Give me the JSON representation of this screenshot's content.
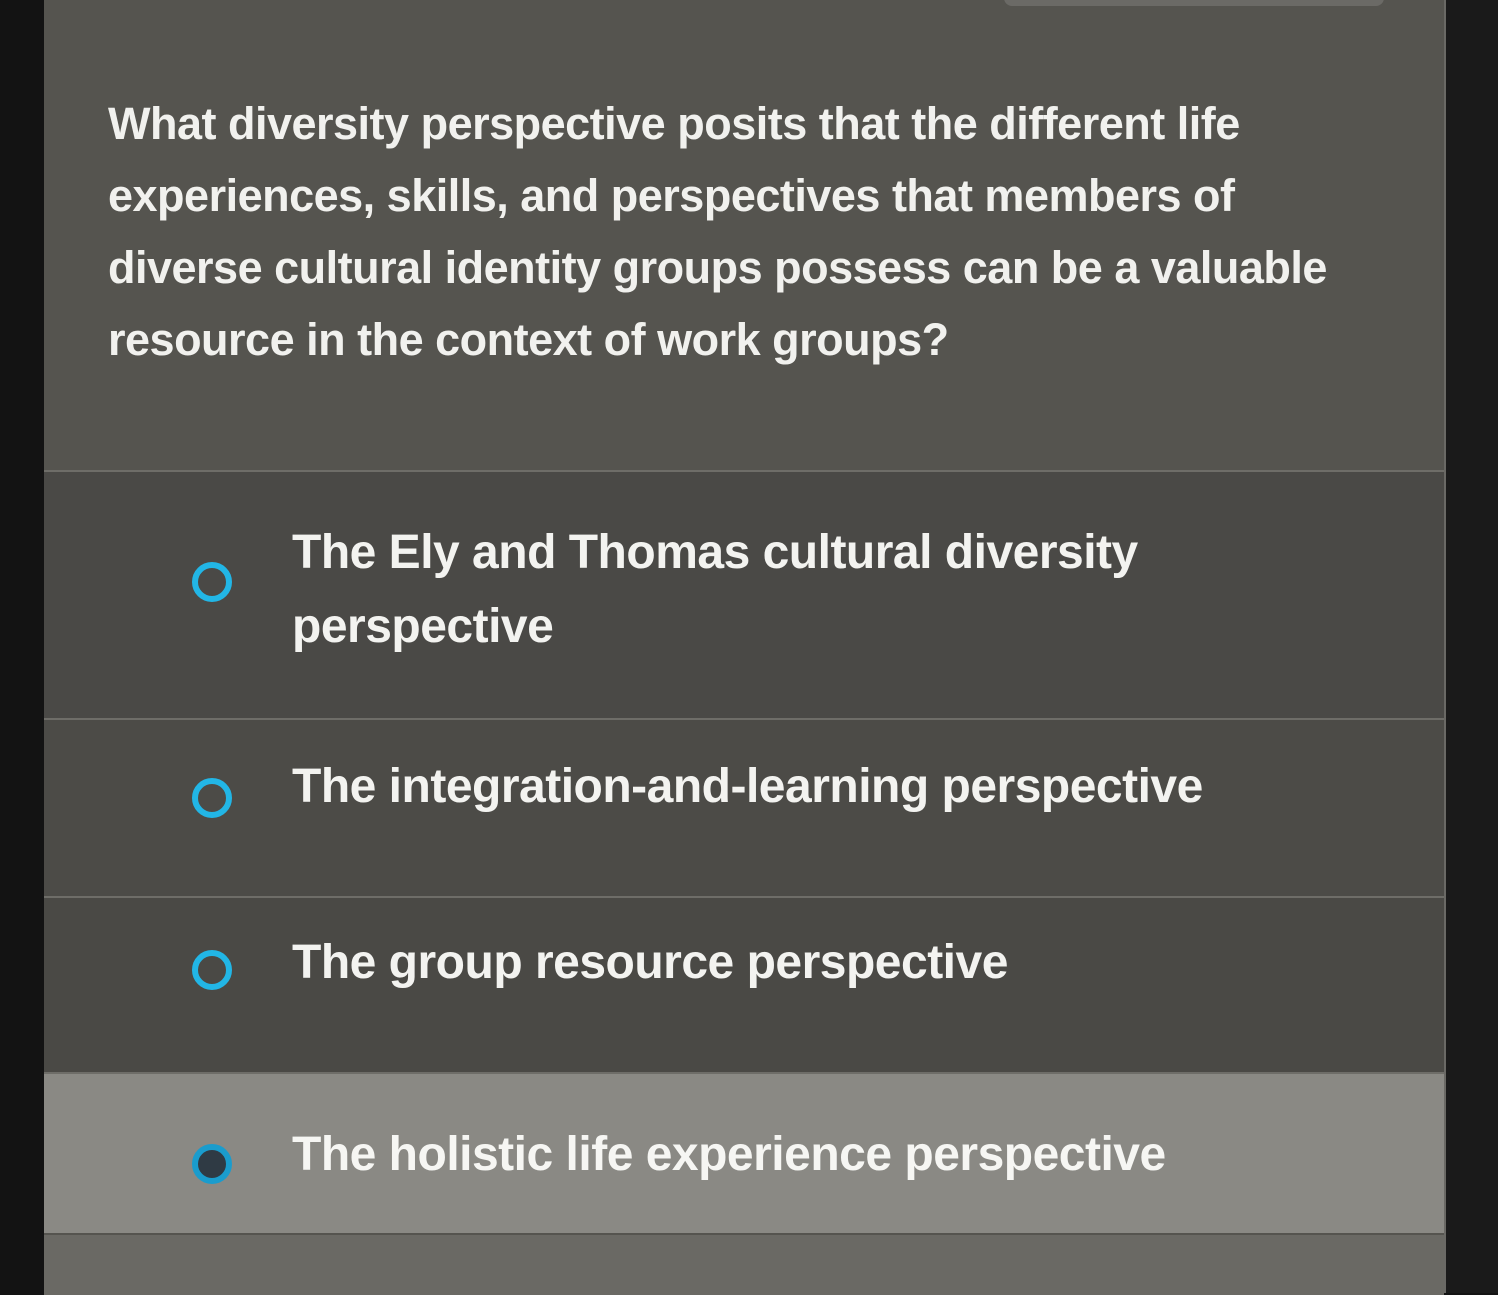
{
  "question": {
    "text": "What diversity perspective posits that the different life experiences, skills, and perspectives that members of diverse cultural identity groups possess can be a valuable resource in the context of work groups?"
  },
  "options": [
    {
      "label": "The Ely and Thomas cultural diversity perspective",
      "selected": false
    },
    {
      "label": "The integration-and-learning perspective",
      "selected": false
    },
    {
      "label": "The group resource perspective",
      "selected": false
    },
    {
      "label": "The holistic life experience perspective",
      "selected": false
    }
  ],
  "colors": {
    "accent": "#22b6e6",
    "panel": "#4e4d49",
    "hover_row": "#8a8984"
  },
  "icons": {
    "radio": "radio-unchecked-icon"
  }
}
